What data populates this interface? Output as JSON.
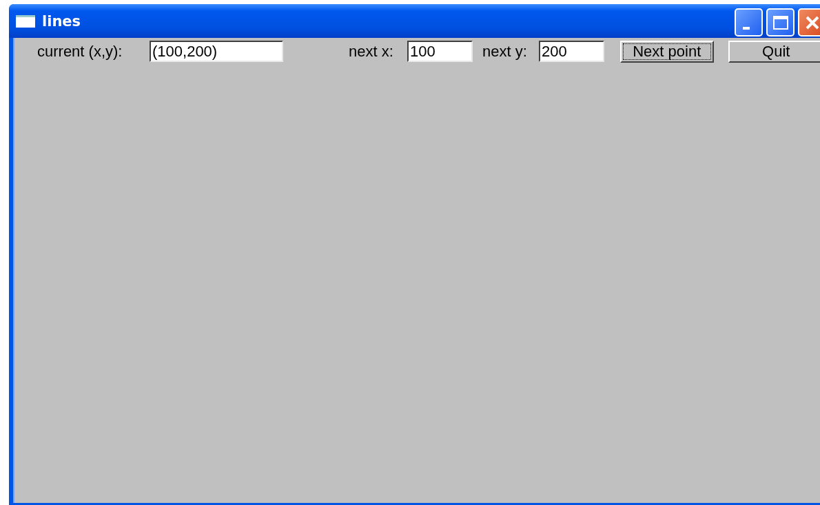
{
  "window": {
    "title": "lines"
  },
  "toolbar": {
    "current_label": "current (x,y):",
    "current_value": "(100,200)",
    "next_x_label": "next x:",
    "next_x_value": "100",
    "next_y_label": "next y:",
    "next_y_value": "200",
    "buttons": [
      {
        "label": "Next point",
        "focused": true
      },
      {
        "label": "Quit",
        "focused": false
      }
    ]
  }
}
